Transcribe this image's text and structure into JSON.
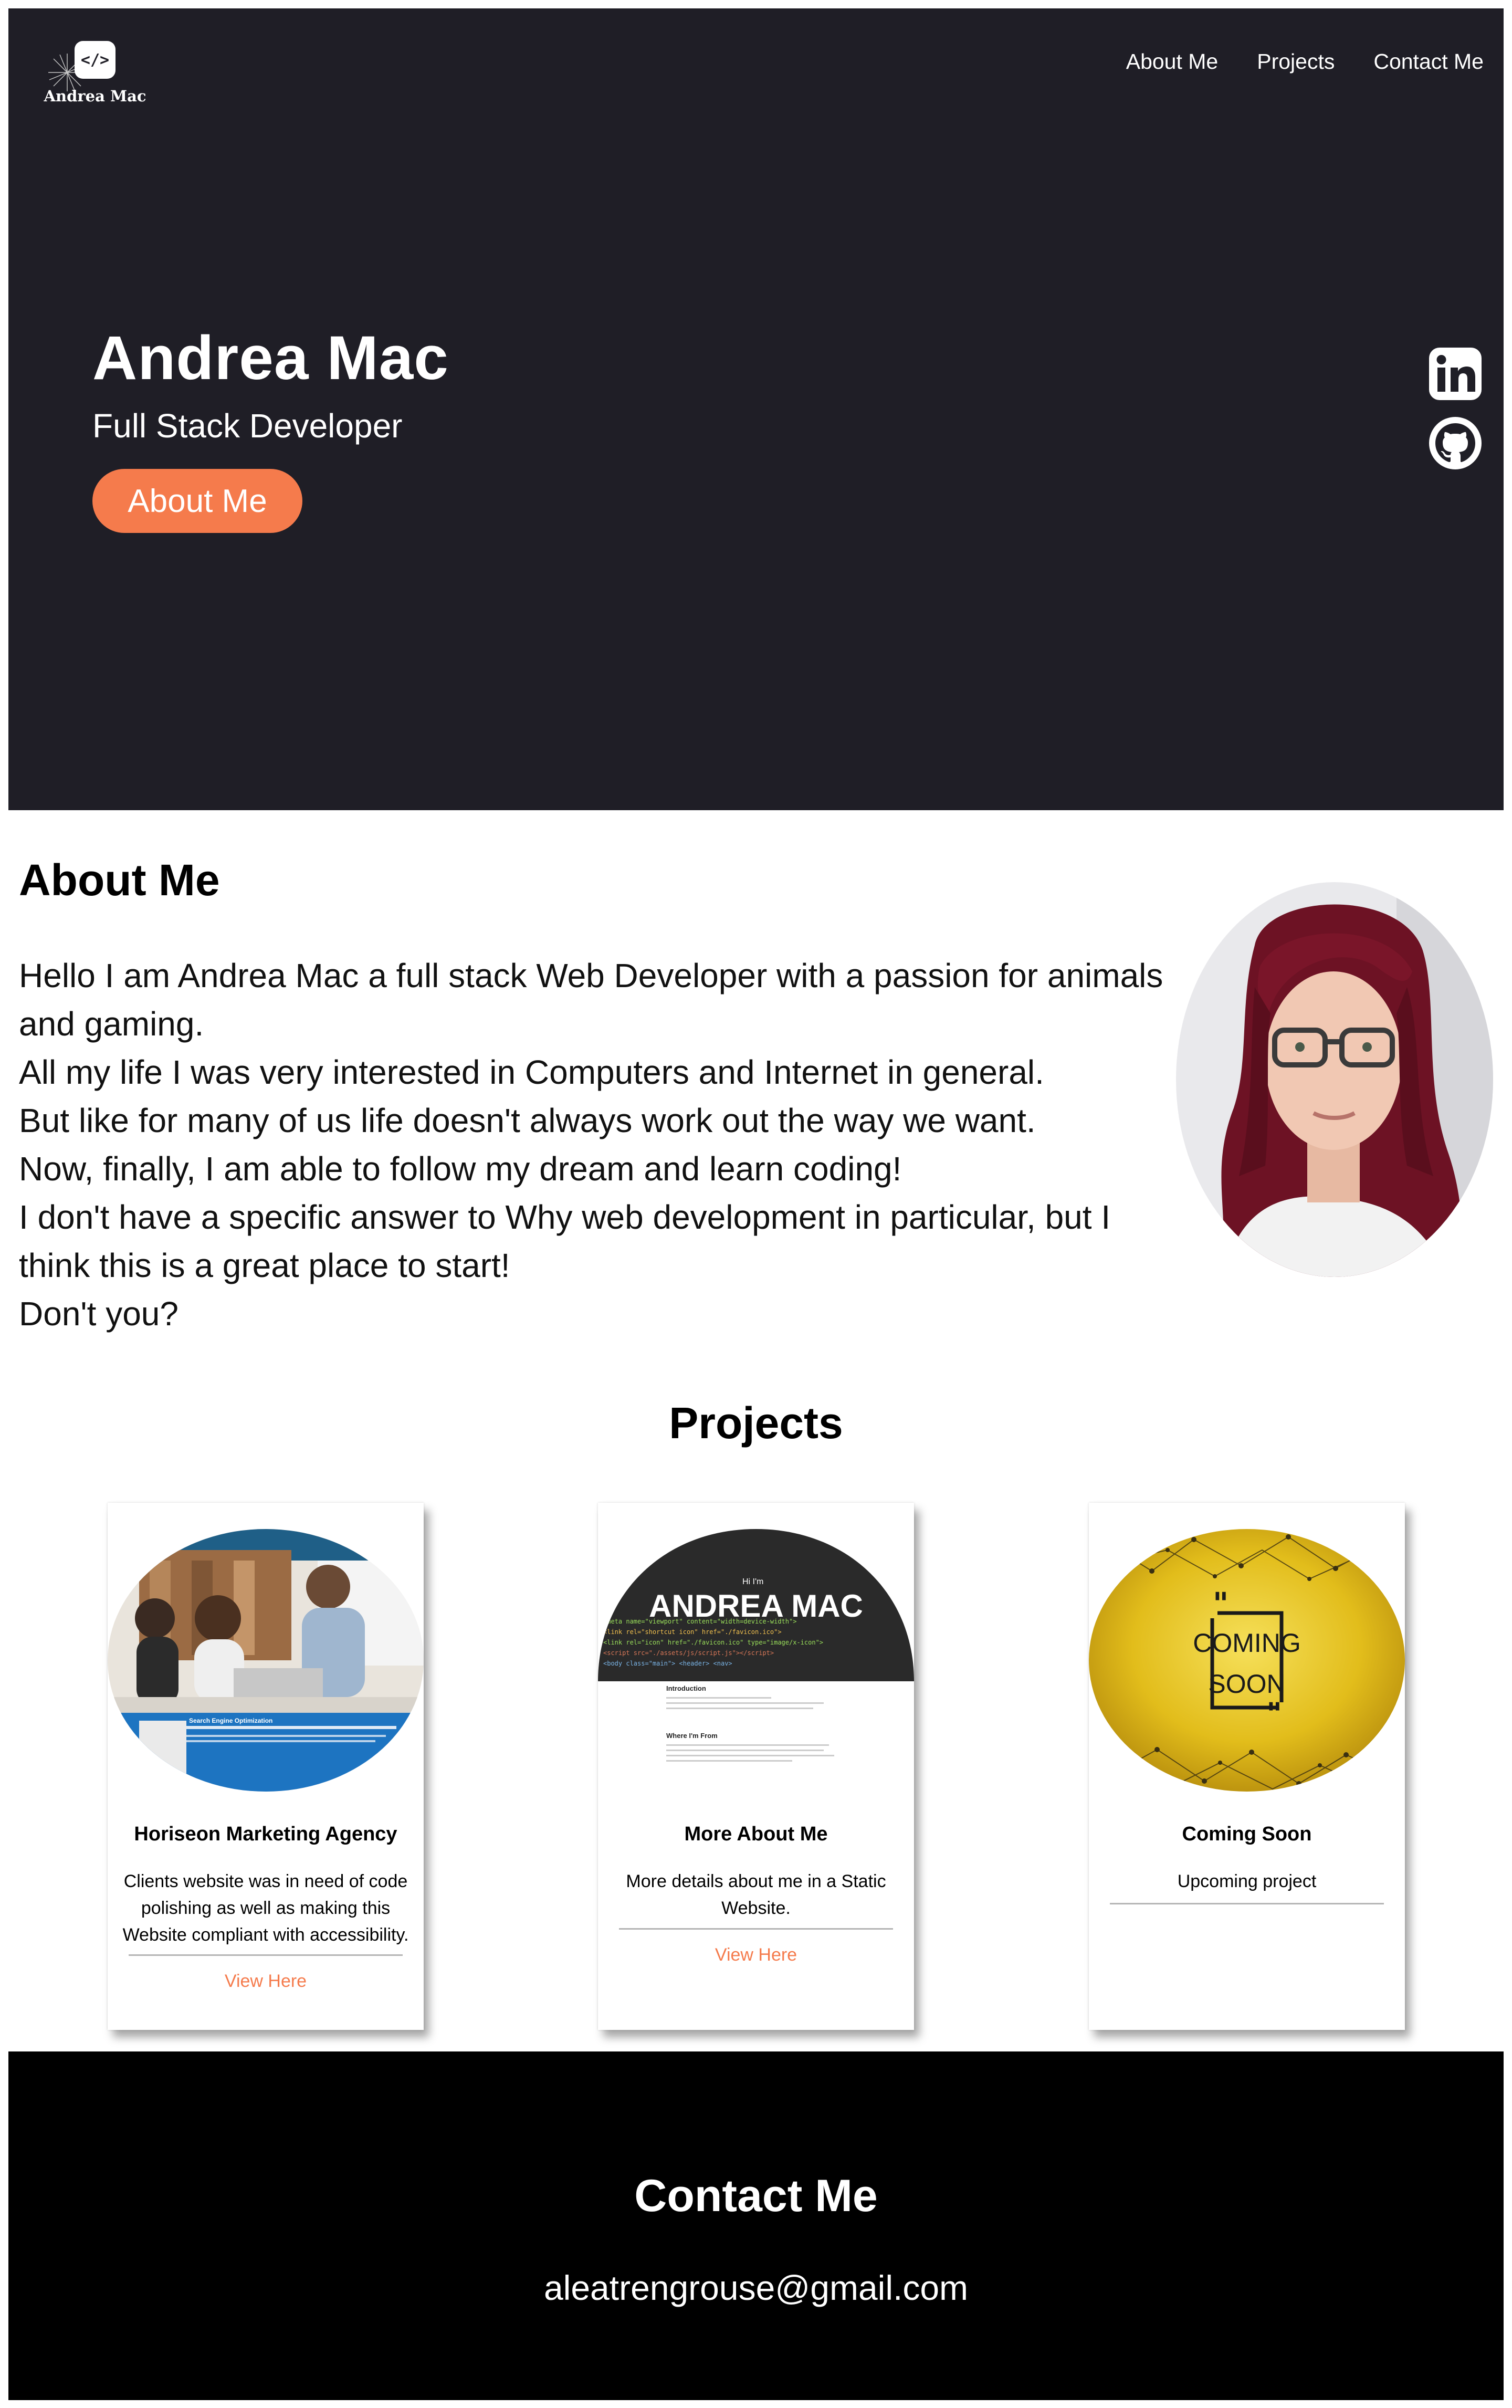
{
  "header": {
    "logo_text": "Andrea Mac",
    "logo_badge": "</>",
    "nav": [
      {
        "label": "About Me"
      },
      {
        "label": "Projects"
      },
      {
        "label": "Contact Me"
      }
    ]
  },
  "hero": {
    "name": "Andrea Mac",
    "role": "Full Stack Developer",
    "button_label": "About Me",
    "social_icons": [
      "linkedin-icon",
      "github-icon"
    ]
  },
  "about": {
    "heading": "About Me",
    "lines": [
      "Hello I am Andrea Mac a full stack Web Developer with a passion for animals and gaming.",
      "All my life I was very interested in Computers and Internet in general.",
      "But like for many of us life doesn't always work out the way we want.",
      "Now, finally, I am able to follow my dream and learn coding!",
      "I don't have a specific answer to Why web development in particular, but I think this is a great place to start!",
      "Don't you?"
    ]
  },
  "projects": {
    "heading": "Projects",
    "cards": [
      {
        "title": "Horiseon Marketing Agency",
        "description": "Clients website was in need of code polishing as well as making this Website compliant with accessibility.",
        "link": "View Here",
        "image_caption": "Search Engine Optimization"
      },
      {
        "title": "More About Me",
        "description": "More details about me in a Static Website.",
        "link": "View Here",
        "image_greeting": "Hi I'm",
        "image_name": "ANDREA MAC",
        "image_section1": "Introduction",
        "image_section2": "Where I'm From"
      },
      {
        "title": "Coming Soon",
        "description": "Upcoming project",
        "image_text_1": "COMING",
        "image_text_2": "SOON"
      }
    ]
  },
  "contact": {
    "heading": "Contact Me",
    "email": "aleatrengrouse@gmail.com"
  },
  "colors": {
    "hero_bg": "#1f1e26",
    "accent": "#f57b4c",
    "footer_bg": "#000000"
  }
}
